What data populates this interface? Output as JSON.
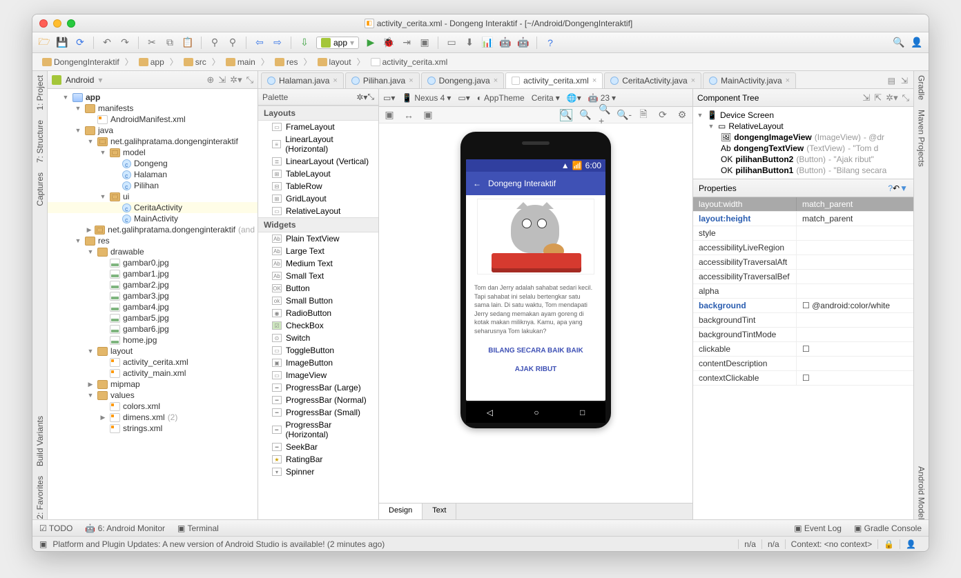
{
  "window": {
    "title": "activity_cerita.xml - Dongeng Interaktif - [~/Android/DongengInteraktif]"
  },
  "breadcrumbs": [
    "DongengInteraktif",
    "app",
    "src",
    "main",
    "res",
    "layout",
    "activity_cerita.xml"
  ],
  "run_config": "app",
  "project_view": "Android",
  "tree": {
    "root": "app",
    "manifests": "manifests",
    "manifest_file": "AndroidManifest.xml",
    "java": "java",
    "pkg1": "net.galihpratama.dongenginteraktif",
    "pkg_model": "model",
    "cls_dongeng": "Dongeng",
    "cls_halaman": "Halaman",
    "cls_pilihan": "Pilihan",
    "pkg_ui": "ui",
    "cls_cerita": "CeritaActivity",
    "cls_main": "MainActivity",
    "pkg2": "net.galihpratama.dongenginteraktif",
    "pkg2_suffix": "(and",
    "res": "res",
    "drawable": "drawable",
    "g0": "gambar0.jpg",
    "g1": "gambar1.jpg",
    "g2": "gambar2.jpg",
    "g3": "gambar3.jpg",
    "g4": "gambar4.jpg",
    "g5": "gambar5.jpg",
    "g6": "gambar6.jpg",
    "home": "home.jpg",
    "layout": "layout",
    "l_cerita": "activity_cerita.xml",
    "l_main": "activity_main.xml",
    "mipmap": "mipmap",
    "values": "values",
    "colors": "colors.xml",
    "dimens": "dimens.xml",
    "dimens_n": "(2)",
    "strings": "strings.xml"
  },
  "tabs": [
    "Halaman.java",
    "Pilihan.java",
    "Dongeng.java",
    "activity_cerita.xml",
    "CeritaActivity.java",
    "MainActivity.java"
  ],
  "active_tab": 3,
  "palette": {
    "title": "Palette",
    "groups": {
      "layouts": "Layouts",
      "widgets": "Widgets"
    },
    "layouts": [
      "FrameLayout",
      "LinearLayout (Horizontal)",
      "LinearLayout (Vertical)",
      "TableLayout",
      "TableRow",
      "GridLayout",
      "RelativeLayout"
    ],
    "widgets": [
      "Plain TextView",
      "Large Text",
      "Medium Text",
      "Small Text",
      "Button",
      "Small Button",
      "RadioButton",
      "CheckBox",
      "Switch",
      "ToggleButton",
      "ImageButton",
      "ImageView",
      "ProgressBar (Large)",
      "ProgressBar (Normal)",
      "ProgressBar (Small)",
      "ProgressBar (Horizontal)",
      "SeekBar",
      "RatingBar",
      "Spinner"
    ]
  },
  "design_toolbar": {
    "device": "Nexus 4",
    "theme": "AppTheme",
    "activity": "Cerita",
    "api": "23"
  },
  "phone": {
    "time": "6:00",
    "title": "Dongeng Interaktif",
    "text": "Tom dan Jerry adalah sahabat sedari kecil. Tapi sahabat ini selalu bertengkar satu sama lain. Di satu waktu, Tom mendapati Jerry sedang memakan ayam goreng di kotak makan miliknya. Kamu, apa yang seharusnya Tom lakukan?",
    "btn1": "BILANG SECARA BAIK BAIK",
    "btn2": "AJAK RIBUT"
  },
  "comp_tree": {
    "title": "Component Tree",
    "root": "Device Screen",
    "rel": "RelativeLayout",
    "items": [
      {
        "name": "dongengImageView",
        "type": "(ImageView)",
        "val": "- @dr"
      },
      {
        "name": "dongengTextView",
        "type": "(TextView)",
        "val": "- \"Tom d"
      },
      {
        "name": "pilihanButton2",
        "type": "(Button)",
        "val": "- \"Ajak ribut\""
      },
      {
        "name": "pilihanButton1",
        "type": "(Button)",
        "val": "- \"Bilang secara"
      }
    ]
  },
  "properties": {
    "title": "Properties",
    "rows": [
      {
        "k": "layout:width",
        "v": "match_parent",
        "hd": true
      },
      {
        "k": "layout:height",
        "v": "match_parent",
        "bold": true
      },
      {
        "k": "style",
        "v": ""
      },
      {
        "k": "accessibilityLiveRegion",
        "v": ""
      },
      {
        "k": "accessibilityTraversalAft",
        "v": ""
      },
      {
        "k": "accessibilityTraversalBef",
        "v": ""
      },
      {
        "k": "alpha",
        "v": ""
      },
      {
        "k": "background",
        "v": "☐ @android:color/white",
        "bold": true
      },
      {
        "k": "backgroundTint",
        "v": ""
      },
      {
        "k": "backgroundTintMode",
        "v": ""
      },
      {
        "k": "clickable",
        "v": "☐"
      },
      {
        "k": "contentDescription",
        "v": ""
      },
      {
        "k": "contextClickable",
        "v": "☐"
      }
    ]
  },
  "gutters": {
    "left": [
      "1: Project",
      "7: Structure",
      "Captures",
      "Build Variants",
      "2: Favorites"
    ],
    "right": [
      "Gradle",
      "Maven Projects",
      "Android Model"
    ]
  },
  "status_tools": [
    "TODO",
    "6: Android Monitor",
    "Terminal"
  ],
  "status_right": [
    "Event Log",
    "Gradle Console"
  ],
  "footer_msg": "Platform and Plugin Updates: A new version of Android Studio is available! (2 minutes ago)",
  "footer_cells": [
    "n/a",
    "n/a",
    "Context: <no context>"
  ],
  "design_tabs": [
    "Design",
    "Text"
  ]
}
